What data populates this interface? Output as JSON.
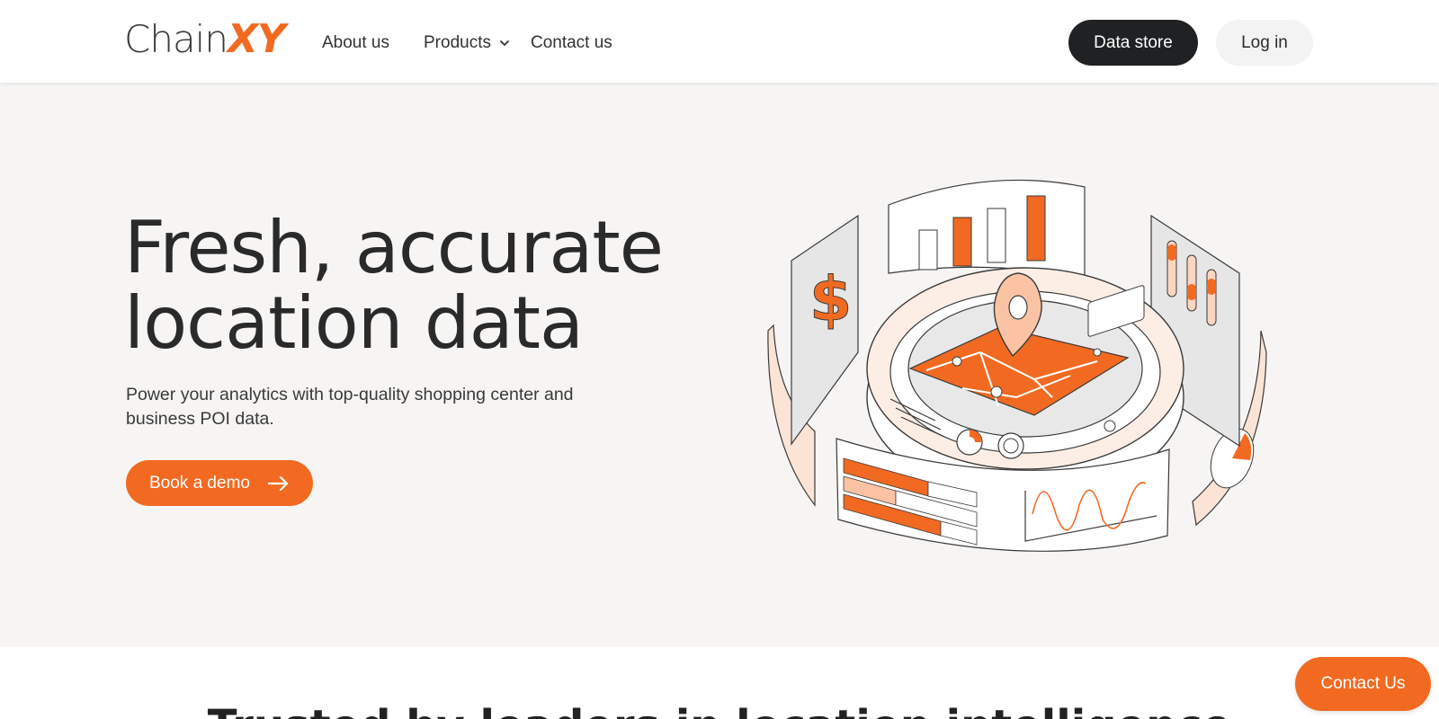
{
  "header": {
    "logo": {
      "part1": "Chain",
      "part2": "XY"
    },
    "nav": {
      "about": "About us",
      "products": "Products",
      "contact": "Contact us"
    },
    "data_store_label": "Data store",
    "login_label": "Log in"
  },
  "hero": {
    "title_line1": "Fresh, accurate",
    "title_line2": "location data",
    "subtitle": "Power your analytics with top-quality shopping center and business POI data.",
    "cta_label": "Book a demo",
    "illustration_icon": "isometric-location-dashboard-illustration"
  },
  "trusted": {
    "heading": "Trusted by leaders in location intelligence"
  },
  "floating_contact_label": "Contact Us",
  "colors": {
    "accent": "#f26a21",
    "dark": "#1f2123",
    "hero_bg": "#f6f5f3",
    "light_button": "#f3f3f3"
  }
}
